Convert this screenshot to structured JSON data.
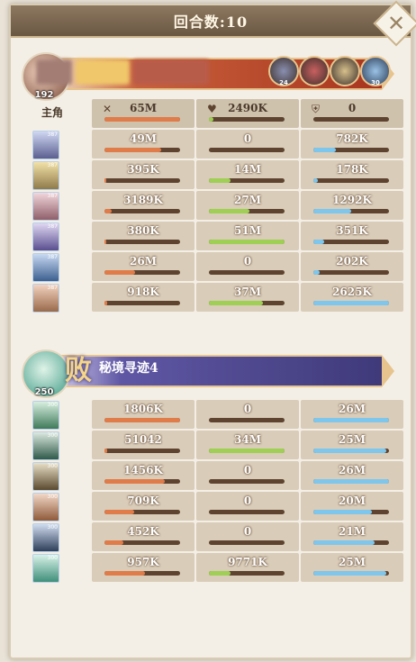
{
  "header": {
    "title": "回合数:10"
  },
  "player": {
    "level": "192",
    "role_label": "主角",
    "skills": [
      "24",
      "",
      "",
      "30"
    ],
    "totals": {
      "damage": "65M",
      "heal": "2490K",
      "shield": "0"
    },
    "totals_icons": [
      "crossed-swords-icon",
      "heart-icon",
      "shield-icon"
    ],
    "rows": [
      {
        "lv": "387",
        "damage": "49M",
        "heal": "0",
        "shield": "782K",
        "dmg_pct": 0.75,
        "heal_pct": 0,
        "sh_pct": 0.3
      },
      {
        "lv": "387",
        "damage": "395K",
        "heal": "14M",
        "shield": "178K",
        "dmg_pct": 0.02,
        "heal_pct": 0.28,
        "sh_pct": 0.06
      },
      {
        "lv": "387",
        "damage": "3189K",
        "heal": "27M",
        "shield": "1292K",
        "dmg_pct": 0.1,
        "heal_pct": 0.53,
        "sh_pct": 0.5
      },
      {
        "lv": "387",
        "damage": "380K",
        "heal": "51M",
        "shield": "351K",
        "dmg_pct": 0.02,
        "heal_pct": 1.0,
        "sh_pct": 0.14
      },
      {
        "lv": "387",
        "damage": "26M",
        "heal": "0",
        "shield": "202K",
        "dmg_pct": 0.4,
        "heal_pct": 0,
        "sh_pct": 0.08
      },
      {
        "lv": "387",
        "damage": "918K",
        "heal": "37M",
        "shield": "2625K",
        "dmg_pct": 0.03,
        "heal_pct": 0.72,
        "sh_pct": 1.0
      }
    ]
  },
  "enemy": {
    "level": "250",
    "result": "败",
    "name": "秘境寻迹4",
    "rows": [
      {
        "lv": "300",
        "damage": "1806K",
        "heal": "0",
        "shield": "26M",
        "dmg_pct": 1.0,
        "heal_pct": 0,
        "sh_pct": 1.0
      },
      {
        "lv": "300",
        "damage": "51042",
        "heal": "34M",
        "shield": "25M",
        "dmg_pct": 0.03,
        "heal_pct": 1.0,
        "sh_pct": 0.96
      },
      {
        "lv": "300",
        "damage": "1456K",
        "heal": "0",
        "shield": "26M",
        "dmg_pct": 0.8,
        "heal_pct": 0,
        "sh_pct": 1.0
      },
      {
        "lv": "300",
        "damage": "709K",
        "heal": "0",
        "shield": "20M",
        "dmg_pct": 0.39,
        "heal_pct": 0,
        "sh_pct": 0.77
      },
      {
        "lv": "300",
        "damage": "452K",
        "heal": "0",
        "shield": "21M",
        "dmg_pct": 0.25,
        "heal_pct": 0,
        "sh_pct": 0.81
      },
      {
        "lv": "300",
        "damage": "957K",
        "heal": "9771K",
        "shield": "25M",
        "dmg_pct": 0.53,
        "heal_pct": 0.29,
        "sh_pct": 0.96
      }
    ]
  },
  "colors": {
    "damage": "#e07b4a",
    "heal": "#9fcf54",
    "shield": "#7fc6ec"
  }
}
